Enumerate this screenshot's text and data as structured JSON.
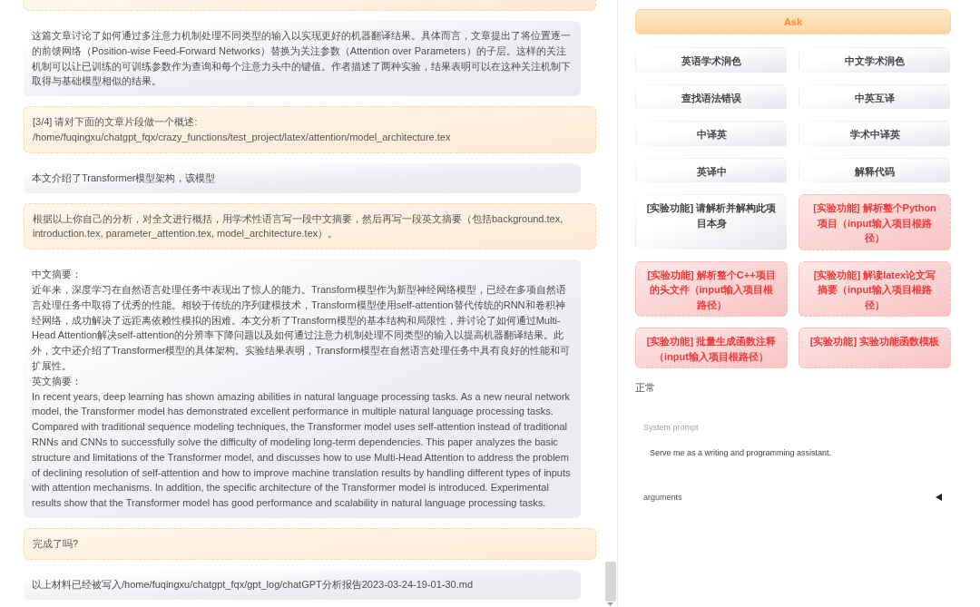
{
  "chat": {
    "messages": [
      {
        "kind": "user"
      },
      {
        "kind": "bot",
        "lines": [
          "这篇文章讨论了如何通过多注意力机制处理不同类型的输入以实现更好的机器翻译结果。具体而言，文章提出了将位置逐一的前馈网络（Position-wise Feed-Forward Networks）替换为关注参数（Attention over Parameters）的子层。这样的关注机制可以让已训练的可训练参数作为查询和每个注意力头中的键值。作者描述了两种实验，结果表明可以在这种关注机制下取得与基础模型相似的结果。"
        ]
      },
      {
        "kind": "user",
        "lines": [
          "[3/4] 请对下面的文章片段做一个概述:",
          "/home/fuqingxu/chatgpt_fqx/crazy_functions/test_project/latex/attention/model_architecture.tex"
        ]
      },
      {
        "kind": "bot",
        "lines": [
          "本文介绍了Transformer模型架构，该模型"
        ]
      },
      {
        "kind": "user",
        "lines": [
          "根据以上你自己的分析，对全文进行概括，用学术性语言写一段中文摘要，然后再写一段英文摘要（包括background.tex, introduction.tex, parameter_attention.tex, model_architecture.tex）。"
        ]
      },
      {
        "kind": "bot",
        "lines": [
          "中文摘要：",
          "近年来，深度学习在自然语言处理任务中表现出了惊人的能力。Transform模型作为新型神经网络模型，已经在多项自然语言处理任务中取得了优秀的性能。相较于传统的序列建模技术，Transform模型使用self-attention替代传统的RNN和卷积神经网络，成功解决了远距离依赖性模拟的困难。本文分析了Transform模型的基本结构和局限性，并讨论了如何通过Multi-Head Attention解决self-attention的分辨率下降问题以及如何通过注意力机制处理不同类型的输入以提高机器翻译结果。此外，文中还介绍了Transformer模型的具体架构。实验结果表明，Transform模型在自然语言处理任务中具有良好的性能和可扩展性。",
          "英文摘要：",
          "In recent years, deep learning has shown amazing abilities in natural language processing tasks. As a new neural network model, the Transformer model has demonstrated excellent performance in multiple natural language processing tasks. Compared with traditional sequence modeling techniques, the Transformer model uses self-attention instead of traditional RNNs and CNNs to successfully solve the difficulty of modeling long-term dependencies. This paper analyzes the basic structure and limitations of the Transformer model, and discusses how to use Multi-Head Attention to address the problem of declining resolution of self-attention and how to improve machine translation results by handling different types of inputs with attention mechanisms. In addition, the specific architecture of the Transformer model is introduced. Experimental results show that the Transformer model has good performance and scalability in natural language processing tasks."
        ]
      },
      {
        "kind": "user",
        "lines": [
          "完成了吗?"
        ]
      },
      {
        "kind": "bot",
        "lines": [
          "以上材料已经被写入/home/fuqingxu/chatgpt_fqx/gpt_log/chatGPT分析报告2023-03-24-19-01-30.md"
        ]
      }
    ]
  },
  "panel": {
    "ask_button": {
      "label": "Ask"
    },
    "function_buttons": [
      {
        "label": "英语学术润色",
        "kind": "plain"
      },
      {
        "label": "中文学术润色",
        "kind": "plain"
      },
      {
        "label": "查找语法错误",
        "kind": "plain"
      },
      {
        "label": "中英互译",
        "kind": "plain"
      },
      {
        "label": "中译英",
        "kind": "plain"
      },
      {
        "label": "学术中译英",
        "kind": "plain"
      },
      {
        "label": "英译中",
        "kind": "plain"
      },
      {
        "label": "解释代码",
        "kind": "plain"
      },
      {
        "label": "[实验功能] 请解析并解构此项目本身",
        "kind": "plain"
      },
      {
        "label": "[实验功能] 解析整个Python项目（input输入项目根路径）",
        "kind": "experimental"
      },
      {
        "label": "[实验功能] 解析整个C++项目的头文件（input输入项目根路径）",
        "kind": "experimental"
      },
      {
        "label": "[实验功能] 解读latex论文写摘要（input输入项目根路径）",
        "kind": "experimental"
      },
      {
        "label": "[实验功能] 批量生成函数注释（input输入项目根路径）",
        "kind": "experimental"
      },
      {
        "label": "[实验功能] 实验功能函数模板",
        "kind": "experimental"
      }
    ],
    "status": "正常",
    "system_prompt": {
      "label": "System prompt",
      "value": "Serve me as a writing and programming assistant."
    },
    "arguments": {
      "label": "arguments",
      "expanded": false
    }
  }
}
